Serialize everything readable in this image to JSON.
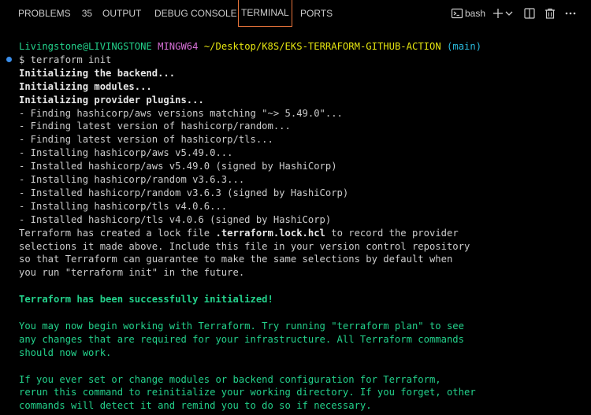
{
  "tabs": {
    "problems_label": "PROBLEMS",
    "problems_count": "35",
    "output_label": "OUTPUT",
    "debug_console_label": "DEBUG CONSOLE",
    "terminal_label": "TERMINAL",
    "ports_label": "PORTS"
  },
  "terminal_toolbar": {
    "shell_label": "bash",
    "icons": [
      "terminal-icon",
      "plus-icon",
      "chevron-down-icon",
      "split-icon",
      "trash-icon",
      "more-icon"
    ]
  },
  "prompt": {
    "user_host": "Livingstone@LIVINGSTONE",
    "env": "MINGW64",
    "path": "~/Desktop/K8S/EKS-TERRAFORM-GITHUB-ACTION",
    "branch": "(main)",
    "command": "$ terraform init"
  },
  "output": {
    "init_backend": "Initializing the backend...",
    "init_modules": "Initializing modules...",
    "init_plugins": "Initializing provider plugins...",
    "plugin_lines": [
      "- Finding hashicorp/aws versions matching \"~> 5.49.0\"...",
      "- Finding latest version of hashicorp/random...",
      "- Finding latest version of hashicorp/tls...",
      "- Installing hashicorp/aws v5.49.0...",
      "- Installed hashicorp/aws v5.49.0 (signed by HashiCorp)",
      "- Installing hashicorp/random v3.6.3...",
      "- Installed hashicorp/random v3.6.3 (signed by HashiCorp)",
      "- Installing hashicorp/tls v4.0.6...",
      "- Installed hashicorp/tls v4.0.6 (signed by HashiCorp)"
    ],
    "lock_pre": "Terraform has created a lock file ",
    "lock_file": ".terraform.lock.hcl",
    "lock_post": " to record the provider",
    "lock_lines": [
      "selections it made above. Include this file in your version control repository",
      "so that Terraform can guarantee to make the same selections by default when",
      "you run \"terraform init\" in the future."
    ],
    "success": "Terraform has been successfully initialized!",
    "begin_lines": [
      "You may now begin working with Terraform. Try running \"terraform plan\" to see",
      "any changes that are required for your infrastructure. All Terraform commands",
      "should now work."
    ],
    "change_lines": [
      "If you ever set or change modules or backend configuration for Terraform,",
      "rerun this command to reinitialize your working directory. If you forget, other",
      "commands will detect it and remind you to do so if necessary."
    ]
  }
}
